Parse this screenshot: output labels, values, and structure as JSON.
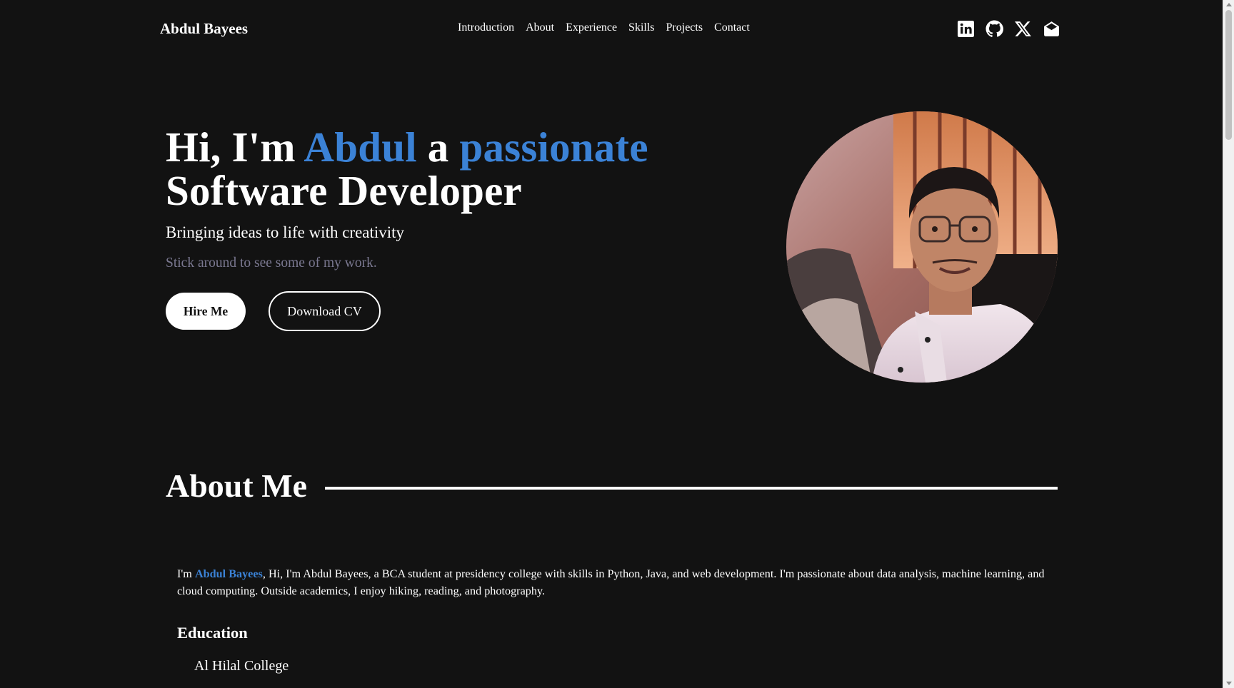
{
  "header": {
    "brand": "Abdul Bayees",
    "nav": [
      "Introduction",
      "About",
      "Experience",
      "Skills",
      "Projects",
      "Contact"
    ],
    "socials": [
      "linkedin-icon",
      "github-icon",
      "x-icon",
      "mail-icon"
    ]
  },
  "hero": {
    "title_part1": "Hi, I'm ",
    "title_name": "Abdul",
    "title_part2": " a ",
    "title_accent": "passionate",
    "title_line2": "Software Developer",
    "tagline": "Bringing ideas to life with creativity",
    "sub": "Stick around to see some of my work.",
    "hire_label": "Hire Me",
    "cv_label": "Download CV"
  },
  "about": {
    "title": "About Me",
    "intro_prefix": "I'm ",
    "intro_name": "Abdul Bayees",
    "intro_text": ", Hi, I'm Abdul Bayees, a BCA student at presidency college with skills in Python, Java, and web development. I'm passionate about data analysis, machine learning, and cloud computing. Outside academics, I enjoy hiking, reading, and photography.",
    "education_title": "Education",
    "education_items": [
      "Al Hilal College"
    ]
  },
  "colors": {
    "background": "#121212",
    "accent": "#3b82d6",
    "muted": "#7a7890"
  }
}
